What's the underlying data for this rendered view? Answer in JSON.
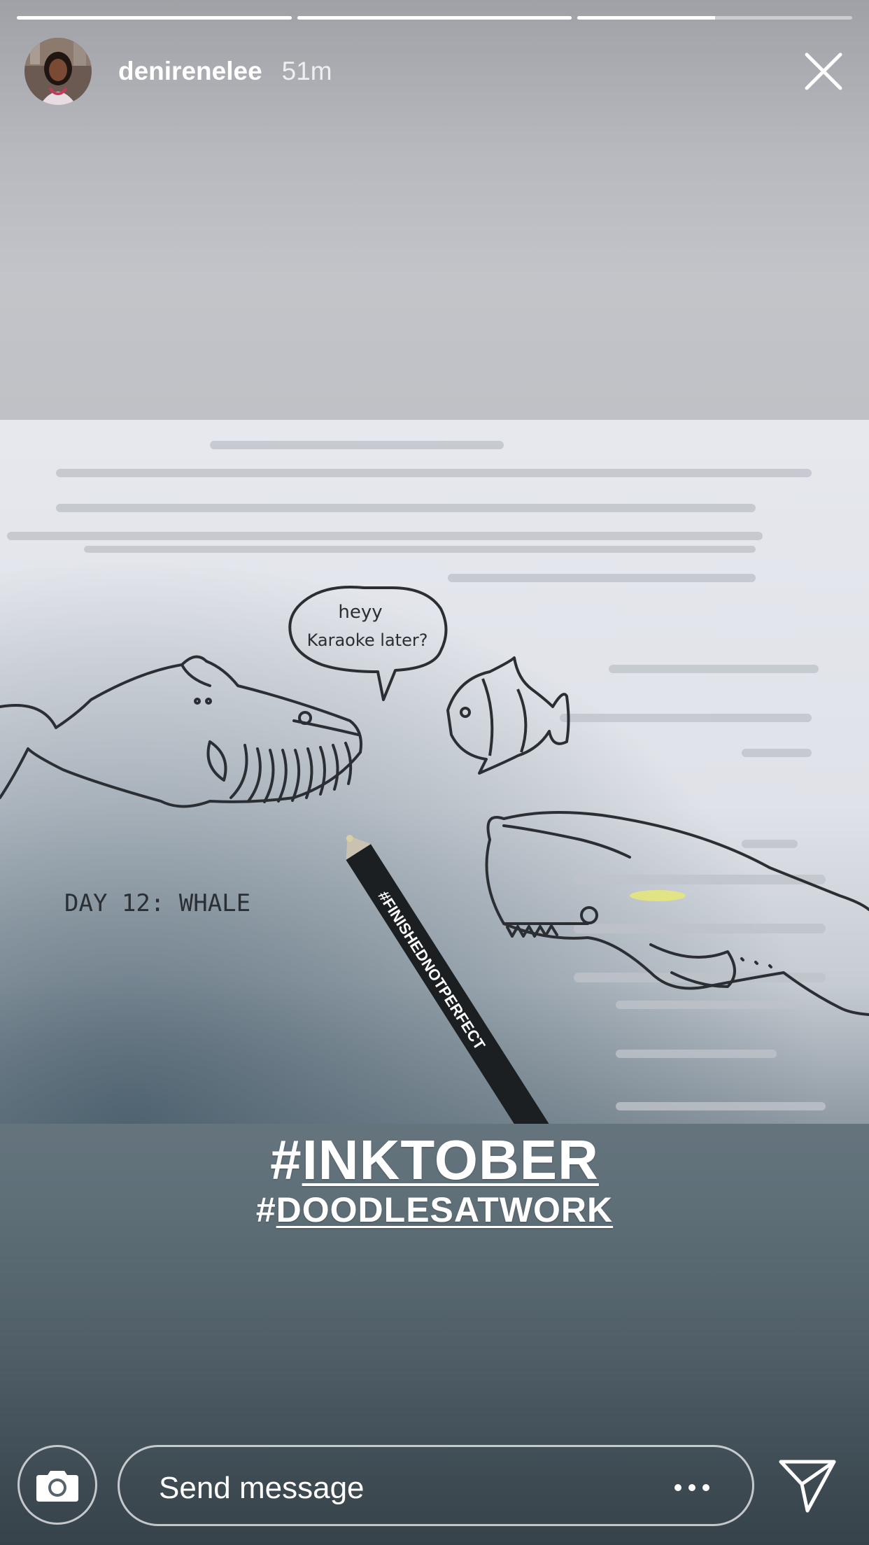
{
  "progress": {
    "segments": [
      {
        "fill": 1.0
      },
      {
        "fill": 1.0
      },
      {
        "fill": 0.5
      }
    ]
  },
  "header": {
    "username": "denirenelee",
    "timestamp": "51m",
    "close_icon": "close-icon"
  },
  "photo": {
    "speech_line1": "heyy",
    "speech_line2": "Karaoke later?",
    "day_label": "DAY 12: WHALE",
    "pen_text": "#FINISHEDNOTPERFECT"
  },
  "stickers": {
    "hashtag1_symbol": "#",
    "hashtag1_word": "INKTOBER",
    "hashtag2_symbol": "#",
    "hashtag2_word": "DOODLESATWORK"
  },
  "footer": {
    "camera_icon": "camera-icon",
    "message_placeholder": "Send message",
    "more_icon": "more-options-icon",
    "send_icon": "send-icon"
  }
}
